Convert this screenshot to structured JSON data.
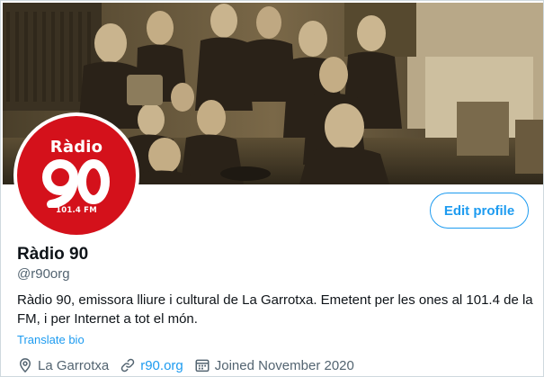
{
  "profile": {
    "logo": {
      "name": "Ràdio",
      "number": "90",
      "frequency": "101.4 FM"
    },
    "edit_label": "Edit profile",
    "display_name": "Ràdio 90",
    "handle": "@r90org",
    "bio": "Ràdio 90, emissora lliure i cultural de La Garrotxa. Emetent per les ones al 101.4 de la FM, i per Internet a tot el món.",
    "translate_label": "Translate bio",
    "location": "La Garrotxa",
    "website": "r90.org",
    "joined": "Joined November 2020"
  },
  "colors": {
    "accent": "#1d9bf0",
    "logo_red": "#d4111b",
    "banner_sepia": "#6b5a3c",
    "secondary_text": "#536471"
  },
  "icons": [
    "location-pin-icon",
    "link-icon",
    "calendar-icon"
  ]
}
